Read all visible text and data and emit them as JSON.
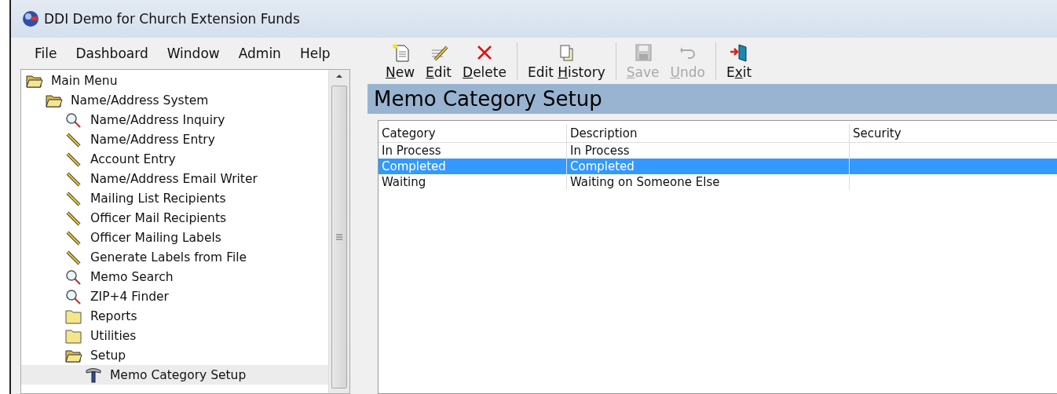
{
  "window": {
    "title": "DDI Demo for Church Extension Funds"
  },
  "menu": [
    "File",
    "Dashboard",
    "Window",
    "Admin",
    "Help"
  ],
  "tree": [
    {
      "label": "Main Menu",
      "kind": "folder-open",
      "selected": false,
      "children": [
        {
          "label": "Name/Address System",
          "kind": "folder-open",
          "selected": false,
          "children": [
            {
              "label": "Name/Address Inquiry",
              "kind": "search",
              "selected": false
            },
            {
              "label": "Name/Address Entry",
              "kind": "pencil",
              "selected": false
            },
            {
              "label": "Account Entry",
              "kind": "pencil",
              "selected": false
            },
            {
              "label": "Name/Address Email Writer",
              "kind": "pencil",
              "selected": false
            },
            {
              "label": "Mailing List Recipients",
              "kind": "pencil",
              "selected": false
            },
            {
              "label": "Officer Mail Recipients",
              "kind": "pencil",
              "selected": false
            },
            {
              "label": "Officer Mailing Labels",
              "kind": "pencil",
              "selected": false
            },
            {
              "label": "Generate Labels from File",
              "kind": "pencil",
              "selected": false
            },
            {
              "label": "Memo Search",
              "kind": "search",
              "selected": false
            },
            {
              "label": "ZIP+4 Finder",
              "kind": "search",
              "selected": false
            },
            {
              "label": "Reports",
              "kind": "folder",
              "selected": false
            },
            {
              "label": "Utilities",
              "kind": "folder",
              "selected": false
            },
            {
              "label": "Setup",
              "kind": "folder-open",
              "selected": false,
              "children": [
                {
                  "label": "Memo Category Setup",
                  "kind": "tool",
                  "selected": true
                }
              ]
            }
          ]
        }
      ]
    }
  ],
  "toolbar": [
    [
      {
        "mnemonic": "N",
        "rest": "ew",
        "kind": "new",
        "disabled": false
      },
      {
        "mnemonic": "E",
        "rest": "dit",
        "kind": "edit",
        "disabled": false
      },
      {
        "mnemonic": "D",
        "rest": "elete",
        "kind": "delete",
        "disabled": false
      }
    ],
    [
      {
        "lead": "Edit ",
        "mnemonic": "H",
        "rest": "istory",
        "kind": "history",
        "disabled": false
      }
    ],
    [
      {
        "mnemonic": "S",
        "rest": "ave",
        "kind": "save",
        "disabled": true
      },
      {
        "mnemonic": "U",
        "rest": "ndo",
        "kind": "undo",
        "disabled": true
      }
    ],
    [
      {
        "lead": "E",
        "mnemonic": "x",
        "rest": "it",
        "kind": "exit",
        "disabled": false
      }
    ]
  ],
  "heading": "Memo Category Setup",
  "table": {
    "columns": [
      "Category",
      "Description",
      "Security"
    ],
    "rows": [
      {
        "cells": [
          "In Process",
          "In Process",
          ""
        ],
        "selected": false
      },
      {
        "cells": [
          "Completed",
          "Completed",
          ""
        ],
        "selected": true
      },
      {
        "cells": [
          "Waiting",
          "Waiting on Someone Else",
          ""
        ],
        "selected": false
      }
    ]
  }
}
